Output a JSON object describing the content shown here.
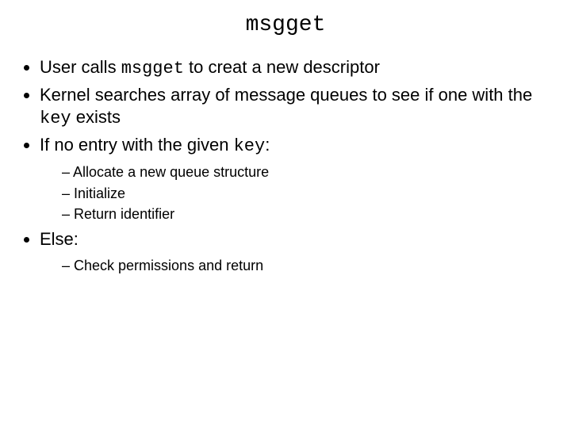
{
  "title": "msgget",
  "bullets": {
    "b1_pre": "User calls ",
    "b1_code": "msgget",
    "b1_post": " to creat a new descriptor",
    "b2_pre": "Kernel searches array of message queues to see if one with the ",
    "b2_code": "key",
    "b2_post": " exists",
    "b3_pre": "If no entry with the given ",
    "b3_code": "key",
    "b3_post": ":",
    "b3_sub1": "Allocate a new queue structure",
    "b3_sub2": "Initialize",
    "b3_sub3": "Return identifier",
    "b4": "Else:",
    "b4_sub1": "Check permissions and return"
  }
}
